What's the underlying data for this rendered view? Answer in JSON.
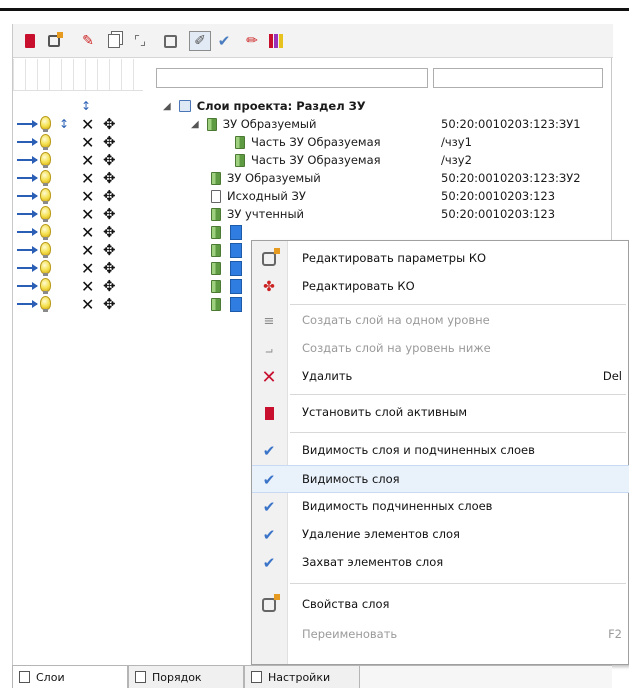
{
  "toolbar": {
    "icons": [
      "active-layer-icon",
      "layer-properties-icon",
      "edit-ko-icon",
      "copy-icon",
      "brackets-icon",
      "zoom-to-layer-icon",
      "edit-mode-icon",
      "check-icon",
      "pen-icon",
      "palette-icon"
    ]
  },
  "tree": {
    "root_label": "Слои проекта: Раздел ЗУ",
    "nodes": [
      {
        "label": "ЗУ Образуемый",
        "value": "50:20:0010203:123:ЗУ1",
        "level": 1,
        "expanded": true
      },
      {
        "label": "Часть ЗУ Образуемая",
        "value": "/чзу1",
        "level": 2
      },
      {
        "label": "Часть ЗУ Образуемая",
        "value": "/чзу2",
        "level": 2
      },
      {
        "label": "ЗУ Образуемый",
        "value": "50:20:0010203:123:ЗУ2",
        "level": 1
      },
      {
        "label": "Исходный ЗУ",
        "value": "50:20:0010203:123",
        "level": 1,
        "source": true
      },
      {
        "label": "ЗУ учтенный",
        "value": "50:20:0010203:123",
        "level": 1
      }
    ]
  },
  "context_menu": {
    "items": [
      {
        "label": "Редактировать параметры КО",
        "icon": "edit-params-icon",
        "enabled": true
      },
      {
        "label": "Редактировать КО",
        "icon": "edit-ko-icon",
        "enabled": true
      },
      {
        "label": "Создать слой на одном уровне",
        "icon": "create-sibling-layer-icon",
        "enabled": false
      },
      {
        "label": "Создать слой на уровень ниже",
        "icon": "create-child-layer-icon",
        "enabled": false
      },
      {
        "label": "Удалить",
        "shortcut": "Del",
        "icon": "delete-icon",
        "enabled": true
      },
      {
        "label": "Установить слой активным",
        "icon": "active-layer-icon",
        "enabled": true
      },
      {
        "label": "Видимость слоя и подчиненных слоев",
        "icon": "check-icon",
        "enabled": true,
        "checked": true
      },
      {
        "label": "Видимость слоя",
        "icon": "check-icon",
        "enabled": true,
        "checked": true
      },
      {
        "label": "Видимость подчиненных слоев",
        "icon": "check-icon",
        "enabled": true,
        "checked": true
      },
      {
        "label": "Удаление элементов слоя",
        "icon": "check-icon",
        "enabled": true,
        "checked": true
      },
      {
        "label": "Захват элементов слоя",
        "icon": "check-icon",
        "enabled": true,
        "checked": true
      },
      {
        "label": "Свойства слоя",
        "icon": "layer-properties-icon",
        "enabled": true
      },
      {
        "label": "Переименовать",
        "shortcut": "F2",
        "icon": "",
        "enabled": false
      }
    ]
  },
  "tabs": [
    {
      "label": "Слои",
      "active": true
    },
    {
      "label": "Порядок",
      "active": false
    },
    {
      "label": "Настройки",
      "active": false
    }
  ],
  "colors": {
    "accent_blue": "#2b5fb5",
    "layer_green": "#5e9a41",
    "active_red": "#c8102e",
    "disabled_text": "#9a9a9a",
    "highlight_bg": "#e9f1fb"
  }
}
